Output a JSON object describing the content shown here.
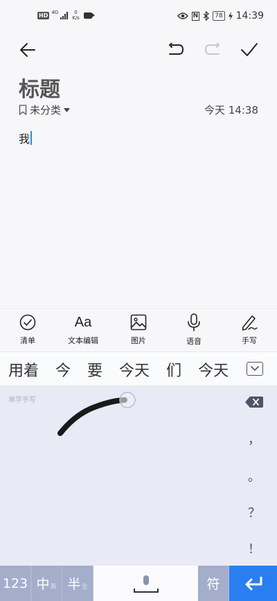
{
  "status_bar": {
    "hd": "HD",
    "network": "4G",
    "rate_value": "0",
    "rate_unit": "K/s",
    "nfc": "N",
    "battery": "78",
    "time": "14:39"
  },
  "note": {
    "title": "标题",
    "category": "未分类",
    "timestamp": "今天 14:38",
    "body": "我"
  },
  "format_toolbar": [
    {
      "icon": "checklist-icon",
      "label": "清单"
    },
    {
      "icon": "text-edit-icon",
      "glyph": "Aa",
      "label": "文本编辑"
    },
    {
      "icon": "image-icon",
      "label": "图片"
    },
    {
      "icon": "microphone-icon",
      "label": "语音"
    },
    {
      "icon": "handwriting-pen-icon",
      "label": "手写"
    }
  ],
  "keyboard": {
    "candidates": [
      "用着",
      "今",
      "要",
      "今天",
      "们",
      "今天"
    ],
    "mode_label": "单字手写",
    "punctuation": [
      "，",
      "。",
      "？",
      "！"
    ],
    "keys": {
      "num": "123",
      "zh": "中",
      "zh_sub": "英",
      "half": "半",
      "half_sub": "全",
      "symbol": "符"
    },
    "colors": {
      "panel": "#e8eaf5",
      "key": "#a4aecb",
      "enter": "#2a7ff0",
      "caret": "#2a8ce0"
    }
  }
}
